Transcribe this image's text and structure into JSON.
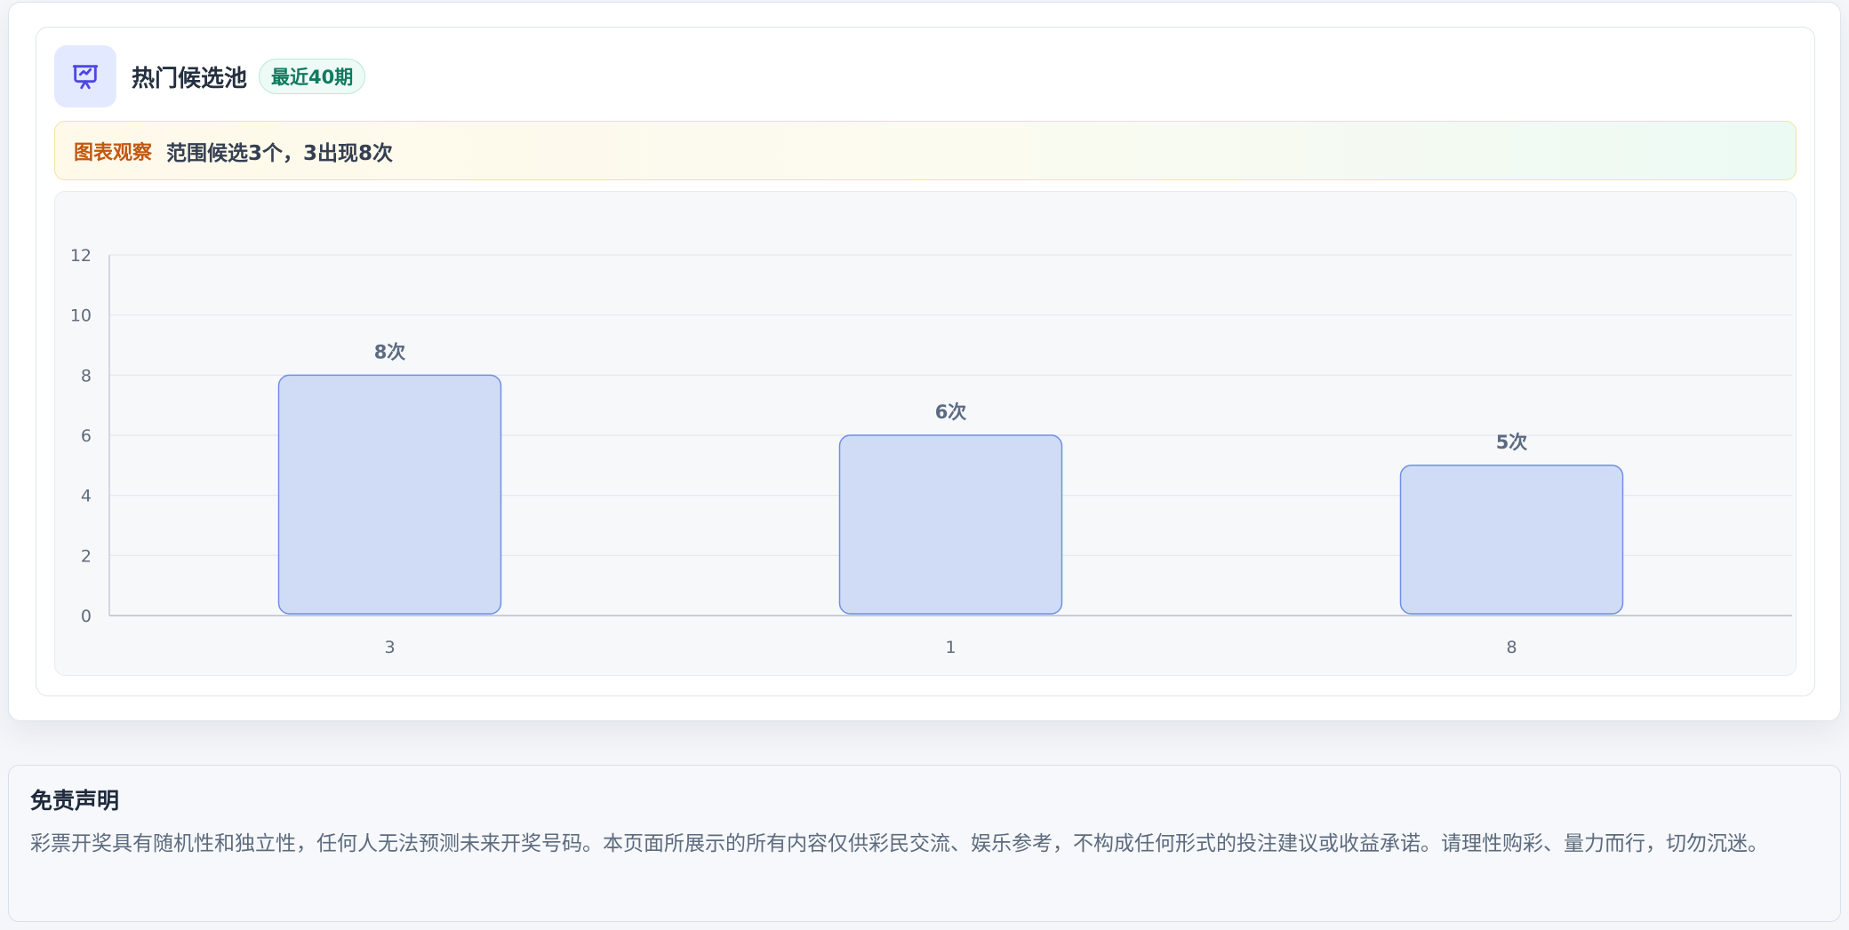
{
  "panel": {
    "icon": "presentation-chart-icon",
    "title": "热门候选池",
    "badge": "最近40期",
    "notice_tag": "图表观察",
    "notice_text": "范围候选3个，3出现8次"
  },
  "chart_data": {
    "type": "bar",
    "categories": [
      "3",
      "1",
      "8"
    ],
    "values": [
      8,
      6,
      5
    ],
    "data_labels": [
      "8次",
      "6次",
      "5次"
    ],
    "yticks": [
      0,
      2,
      4,
      6,
      8,
      10,
      12
    ],
    "ylim": [
      0,
      12
    ],
    "grid": true,
    "bar_fill": "#d0dcf6",
    "bar_stroke": "#6f8fe6"
  },
  "disclaimer": {
    "title": "免责声明",
    "text": "彩票开奖具有随机性和独立性，任何人无法预测未来开奖号码。本页面所展示的所有内容仅供彩民交流、娱乐参考，不构成任何形式的投注建议或收益承诺。请理性购彩、量力而行，切勿沉迷。"
  },
  "colors": {
    "accent_icon": "#4f46e5",
    "badge_text": "#0f7a5f",
    "notice_tag": "#c2580e"
  }
}
